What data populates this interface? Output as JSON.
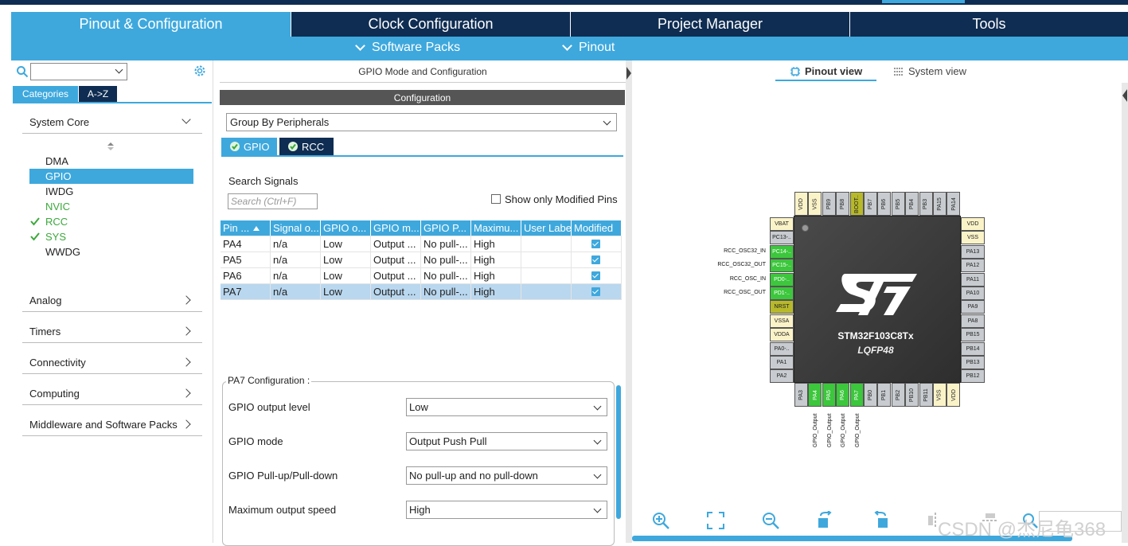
{
  "main_tabs": {
    "pinout": "Pinout & Configuration",
    "clock": "Clock Configuration",
    "project": "Project Manager",
    "tools": "Tools"
  },
  "sub_menu": {
    "software_packs": "Software Packs",
    "pinout": "Pinout"
  },
  "left": {
    "categories_tab": "Categories",
    "az_tab": "A->Z",
    "system_core": "System Core",
    "peripherals": [
      {
        "label": "DMA",
        "state": "normal"
      },
      {
        "label": "GPIO",
        "state": "selected"
      },
      {
        "label": "IWDG",
        "state": "normal"
      },
      {
        "label": "NVIC",
        "state": "green"
      },
      {
        "label": "RCC",
        "state": "checked"
      },
      {
        "label": "SYS",
        "state": "checked"
      },
      {
        "label": "WWDG",
        "state": "normal"
      }
    ],
    "groups": [
      "Analog",
      "Timers",
      "Connectivity",
      "Computing",
      "Middleware and Software Packs"
    ]
  },
  "middle": {
    "header": "GPIO Mode and Configuration",
    "config_title": "Configuration",
    "group_by": "Group By Peripherals",
    "tabs": [
      "GPIO",
      "RCC"
    ],
    "search_label": "Search Signals",
    "search_placeholder": "Search (Ctrl+F)",
    "show_modified": "Show only Modified Pins",
    "table": {
      "headers": [
        "Pin ...",
        "Signal o...",
        "GPIO o...",
        "GPIO m...",
        "GPIO P...",
        "Maximu...",
        "User Label",
        "Modified"
      ],
      "rows": [
        [
          "PA4",
          "n/a",
          "Low",
          "Output ...",
          "No pull-...",
          "High",
          "",
          ""
        ],
        [
          "PA5",
          "n/a",
          "Low",
          "Output ...",
          "No pull-...",
          "High",
          "",
          ""
        ],
        [
          "PA6",
          "n/a",
          "Low",
          "Output ...",
          "No pull-...",
          "High",
          "",
          ""
        ],
        [
          "PA7",
          "n/a",
          "Low",
          "Output ...",
          "No pull-...",
          "High",
          "",
          ""
        ]
      ]
    },
    "pa7_config": {
      "legend": "PA7 Configuration :",
      "fields": [
        {
          "label": "GPIO output level",
          "value": "Low"
        },
        {
          "label": "GPIO mode",
          "value": "Output Push Pull"
        },
        {
          "label": "GPIO Pull-up/Pull-down",
          "value": "No pull-up and no pull-down"
        },
        {
          "label": "Maximum output speed",
          "value": "High"
        }
      ]
    }
  },
  "right": {
    "pinout_view": "Pinout view",
    "system_view": "System view",
    "chip_name": "STM32F103C8Tx",
    "chip_package": "LQFP48",
    "top_pins": [
      "VDD",
      "VSS",
      "PB9",
      "PB8",
      "BOOT..",
      "PB7",
      "PB6",
      "PB5",
      "PB4",
      "PB3",
      "PA15",
      "PA14"
    ],
    "left_pins": [
      "VBAT",
      "PC13-..",
      "PC14-..",
      "PC15-..",
      "PD0-..",
      "PD1-..",
      "NRST",
      "VSSA",
      "VDDA",
      "PA0-..",
      "PA1",
      "PA2"
    ],
    "right_pins": [
      "VDD",
      "VSS",
      "PA13",
      "PA12",
      "PA11",
      "PA10",
      "PA9",
      "PA8",
      "PB15",
      "PB14",
      "PB13",
      "PB12"
    ],
    "bottom_pins": [
      "PA3",
      "PA4",
      "PA5",
      "PA6",
      "PA7",
      "PB0",
      "PB1",
      "PB2",
      "PB10",
      "PB11",
      "VSS",
      "VDD"
    ],
    "left_signals": [
      "RCC_OSC32_IN",
      "RCC_OSC32_OUT",
      "RCC_OSC_IN",
      "RCC_OSC_OUT"
    ],
    "bottom_signals": [
      "GPIO_Output",
      "GPIO_Output",
      "GPIO_Output",
      "GPIO_Output"
    ]
  },
  "watermark": "CSDN @杰尼龟368"
}
